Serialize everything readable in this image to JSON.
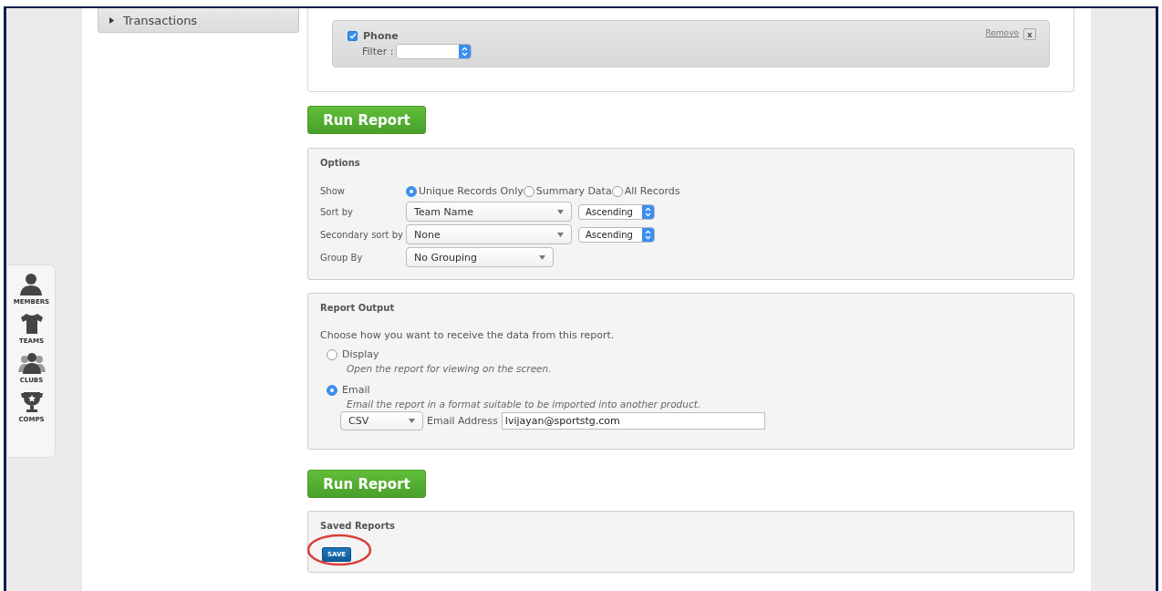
{
  "sidebar_menu": {
    "items": [
      {
        "label": "Transactions"
      }
    ]
  },
  "filters": [
    {
      "label": "Phone",
      "checked": true,
      "filter_label": "Filter :",
      "remove_label": "Remove",
      "remove_icon": "x"
    }
  ],
  "run_report_top": "Run Report",
  "options": {
    "title": "Options",
    "show": {
      "label": "Show",
      "choices": [
        {
          "label": "Unique Records Only",
          "selected": true
        },
        {
          "label": "Summary Data",
          "selected": false
        },
        {
          "label": "All Records",
          "selected": false
        }
      ]
    },
    "sorts": [
      {
        "label": "Sort by",
        "value": "Team Name",
        "order": "Ascending"
      },
      {
        "label": "Secondary sort by",
        "value": "None",
        "order": "Ascending"
      }
    ],
    "group_by": {
      "label": "Group By",
      "value": "No Grouping"
    }
  },
  "report_output": {
    "title": "Report Output",
    "intro": "Choose how you want to receive the data from this report.",
    "choices": [
      {
        "label": "Display",
        "description": "Open the report for viewing on the screen.",
        "selected": false
      },
      {
        "label": "Email",
        "description": "Email the report in a format suitable to be imported into another product.",
        "selected": true
      }
    ],
    "format": "CSV",
    "email_label": "Email Address",
    "email": "lvijayan@sportstg.com"
  },
  "run_report_bottom": "Run Report",
  "saved_reports": {
    "title": "Saved Reports",
    "save_button": "SAVE"
  },
  "nav": [
    {
      "label": "MEMBERS",
      "kind": "member"
    },
    {
      "label": "TEAMS",
      "kind": "team"
    },
    {
      "label": "CLUBS",
      "kind": "club"
    },
    {
      "label": "COMPS",
      "kind": "comp"
    }
  ]
}
